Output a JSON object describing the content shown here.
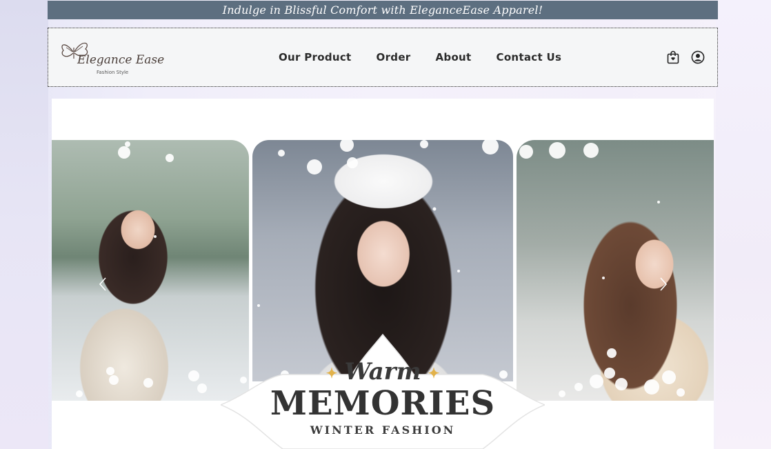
{
  "banner": {
    "text": "Indulge in Blissful Comfort with EleganceEase Apparel!"
  },
  "logo": {
    "name": "Elegance Ease",
    "tagline": "Fashion Style"
  },
  "nav": {
    "items": [
      "Our Product",
      "Order",
      "About",
      "Contact Us"
    ]
  },
  "header_icons": [
    "shopping-bag-icon",
    "user-account-icon"
  ],
  "hero": {
    "badge_script": "Warm",
    "badge_title": "MEMORIES",
    "badge_subtitle": "WINTER FASHION",
    "prev_icon": "chevron-left-icon",
    "next_icon": "chevron-right-icon"
  },
  "colors": {
    "banner_bg": "#5d6f80",
    "header_bg": "#f5f6f7",
    "accent_star": "#e2b24a"
  }
}
